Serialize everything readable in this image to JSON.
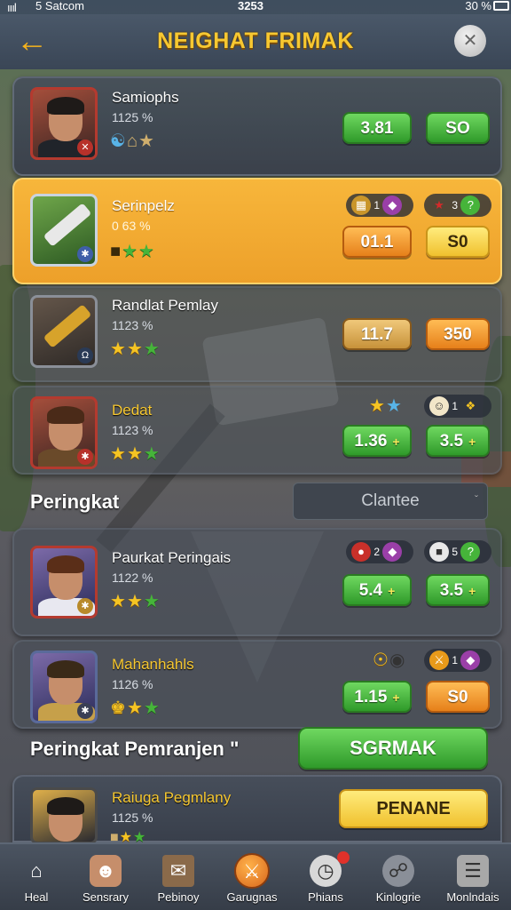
{
  "status": {
    "signal": "ıııl",
    "carrier": "5 Satcom",
    "time": "3253",
    "battery": "30 %"
  },
  "header": {
    "title": "NEIGHAT FRIMAK",
    "back_icon": "back-arrow-icon",
    "close_icon": "close-icon"
  },
  "cards": [
    {
      "name": "Samiophs",
      "pct": "1125 %",
      "btn1": "3.81",
      "btn2": "SO"
    },
    {
      "name": "Serinpelz",
      "pct": "0 63 %",
      "mini1": "1",
      "mini2": "3",
      "btn1": "01.1",
      "btn2": "S0"
    },
    {
      "name": "Randlat Pemlay",
      "pct": "1123 %",
      "btn1": "11.7",
      "btn2": "350"
    },
    {
      "name": "Dedat",
      "pct": "1123 %",
      "mini2": "1",
      "btn1": "1.36",
      "btn2": "3.5"
    },
    {
      "name": "Paurkat Peringais",
      "pct": "1122 %",
      "mini1": "2",
      "mini2": "5",
      "btn1": "5.4",
      "btn2": "3.5"
    },
    {
      "name": "Mahanhahls",
      "pct": "1126 %",
      "mini2": "1",
      "btn1": "1.15",
      "btn2": "S0"
    },
    {
      "name": "Raiuga Pegmlany",
      "pct": "1125 %",
      "btn1": "PENANE"
    }
  ],
  "section1": {
    "title": "Peringkat",
    "select_value": "Clantee"
  },
  "section2": {
    "title": "Peringkat Pemranjen \"",
    "button": "SGRMAK"
  },
  "nav": [
    {
      "label": "Heal",
      "icon": "home-icon"
    },
    {
      "label": "Sensrary",
      "icon": "profile-icon"
    },
    {
      "label": "Pebinoy",
      "icon": "mail-icon"
    },
    {
      "label": "Garugnas",
      "icon": "crossed-tools-icon"
    },
    {
      "label": "Phians",
      "icon": "clock-icon"
    },
    {
      "label": "Kinlogrie",
      "icon": "globe-icon"
    },
    {
      "label": "Monlndais",
      "icon": "menu-icon"
    }
  ],
  "colors": {
    "accent": "#f7c831",
    "highlight": "#f7b63b",
    "green": "#2f9a2a",
    "orange": "#e6801a"
  }
}
